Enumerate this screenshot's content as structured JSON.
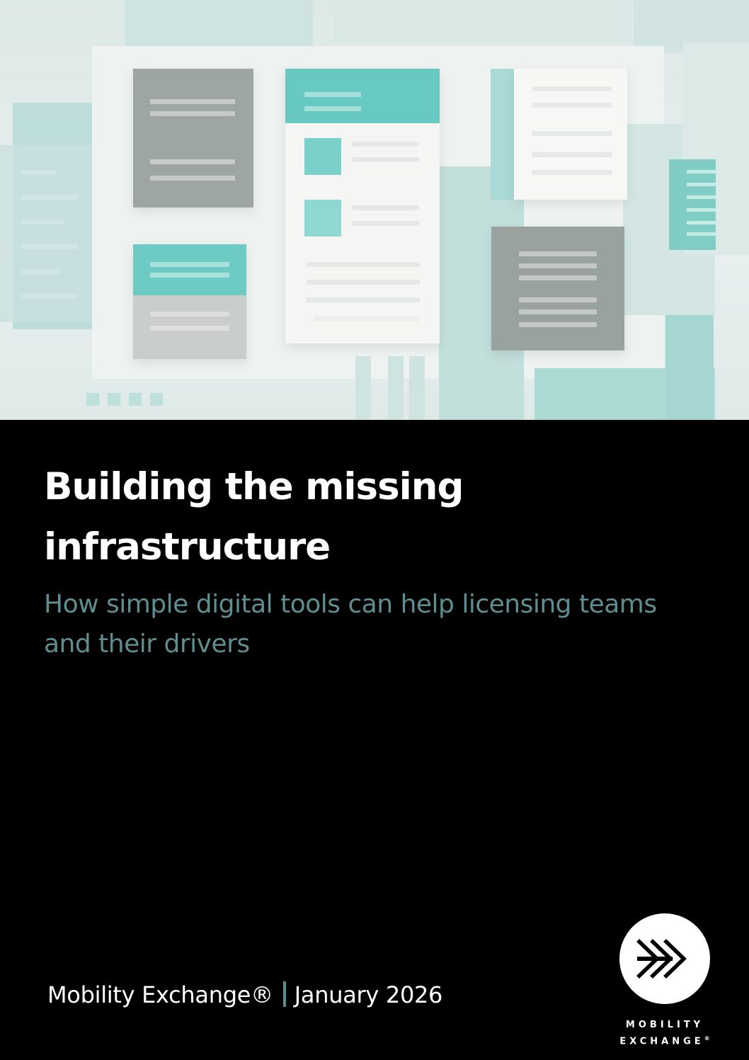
{
  "title": "Building the missing infrastructure",
  "subtitle": "How simple digital tools can help licensing teams and their drivers",
  "footer": {
    "brand": "Mobility Exchange®",
    "date": "January 2026"
  },
  "logo": {
    "line1": "MOBILITY",
    "line2": "EXCHANGE",
    "mark": "®",
    "icon": "chevrons-icon"
  },
  "colors": {
    "background": "#000000",
    "title": "#ffffff",
    "subtitle": "#5f8e91",
    "accent": "#63c8c0",
    "hero_background": "#e3ecea"
  }
}
